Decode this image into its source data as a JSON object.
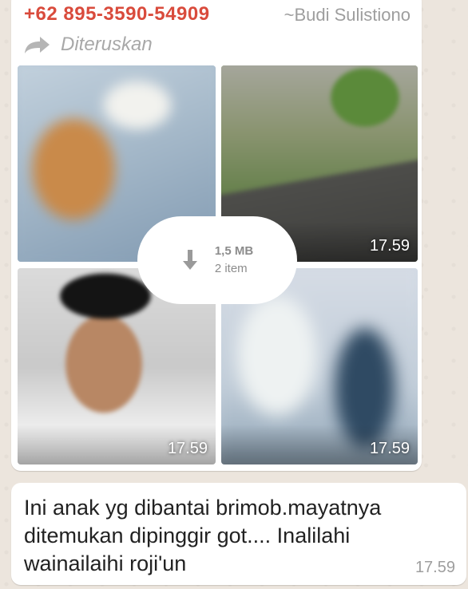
{
  "sender": {
    "phone": "+62 895-3590-54909",
    "name": "~Budi Sulistiono"
  },
  "forwarded_label": "Diteruskan",
  "album": {
    "download": {
      "size": "1,5 MB",
      "count": "2 item"
    },
    "thumbs": [
      {
        "time": ""
      },
      {
        "time": "17.59"
      },
      {
        "time": "17.59"
      },
      {
        "time": "17.59"
      }
    ]
  },
  "message": {
    "text": "Ini anak yg dibantai brimob.mayatnya ditemukan dipinggir got.... Inalilahi wainailaihi roji'un",
    "time": "17.59"
  },
  "colors": {
    "sender": "#d94b3c",
    "bubble": "#ffffff",
    "wallpaper": "#ece5dd"
  },
  "icons": {
    "forward": "forward-arrow-icon",
    "download": "download-arrow-icon"
  }
}
